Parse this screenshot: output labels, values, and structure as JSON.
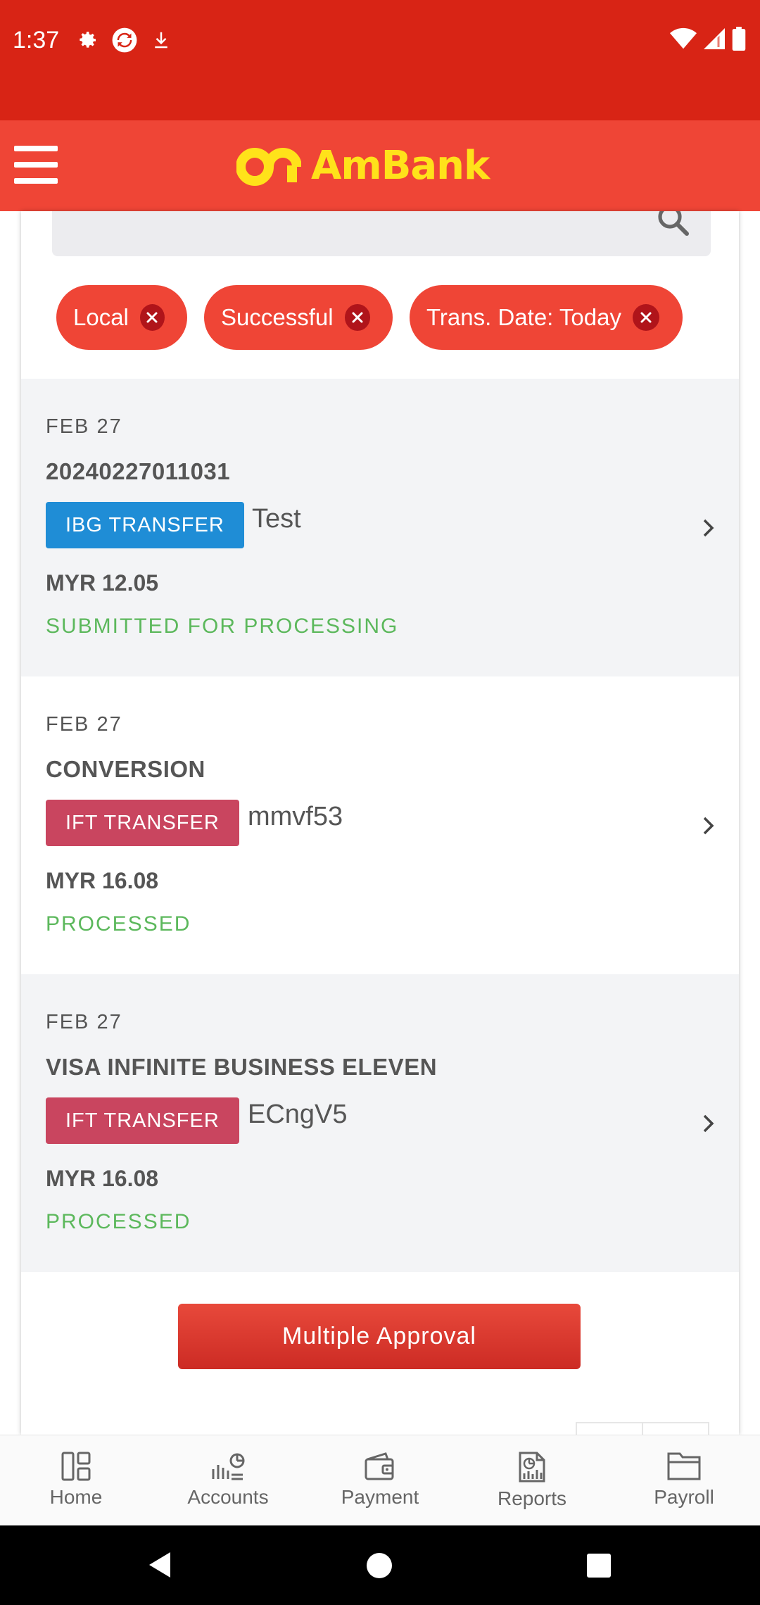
{
  "status_bar": {
    "time": "1:37"
  },
  "app": {
    "brand": "AmBank"
  },
  "filters": [
    {
      "label": "Local"
    },
    {
      "label": "Successful"
    },
    {
      "label": "Trans. Date: Today"
    }
  ],
  "transactions": [
    {
      "date": "FEB  27",
      "reference": "20240227011031",
      "type": "IBG TRANSFER",
      "description": "Test",
      "amount": "MYR 12.05",
      "status": "SUBMITTED FOR PROCESSING"
    },
    {
      "date": "FEB  27",
      "reference": "CONVERSION",
      "type": "IFT TRANSFER",
      "description": "mmvf53",
      "amount": "MYR 16.08",
      "status": "PROCESSED"
    },
    {
      "date": "FEB  27",
      "reference": "VISA INFINITE BUSINESS ELEVEN",
      "type": "IFT TRANSFER",
      "description": "ECngV5",
      "amount": "MYR 16.08",
      "status": "PROCESSED"
    }
  ],
  "actions": {
    "multiple_approval": "Multiple Approval"
  },
  "bottom_nav": [
    {
      "label": "Home",
      "icon": "home-icon"
    },
    {
      "label": "Accounts",
      "icon": "accounts-icon"
    },
    {
      "label": "Payment",
      "icon": "wallet-icon"
    },
    {
      "label": "Reports",
      "icon": "reports-icon"
    },
    {
      "label": "Payroll",
      "icon": "payroll-icon"
    }
  ],
  "colors": {
    "status_bar": "#d82415",
    "header": "#ef4536",
    "brand_text": "#ffe21a",
    "ibg_badge": "#1f8dd6",
    "ift_badge": "#c9455f",
    "status_text": "#5cb85c"
  }
}
